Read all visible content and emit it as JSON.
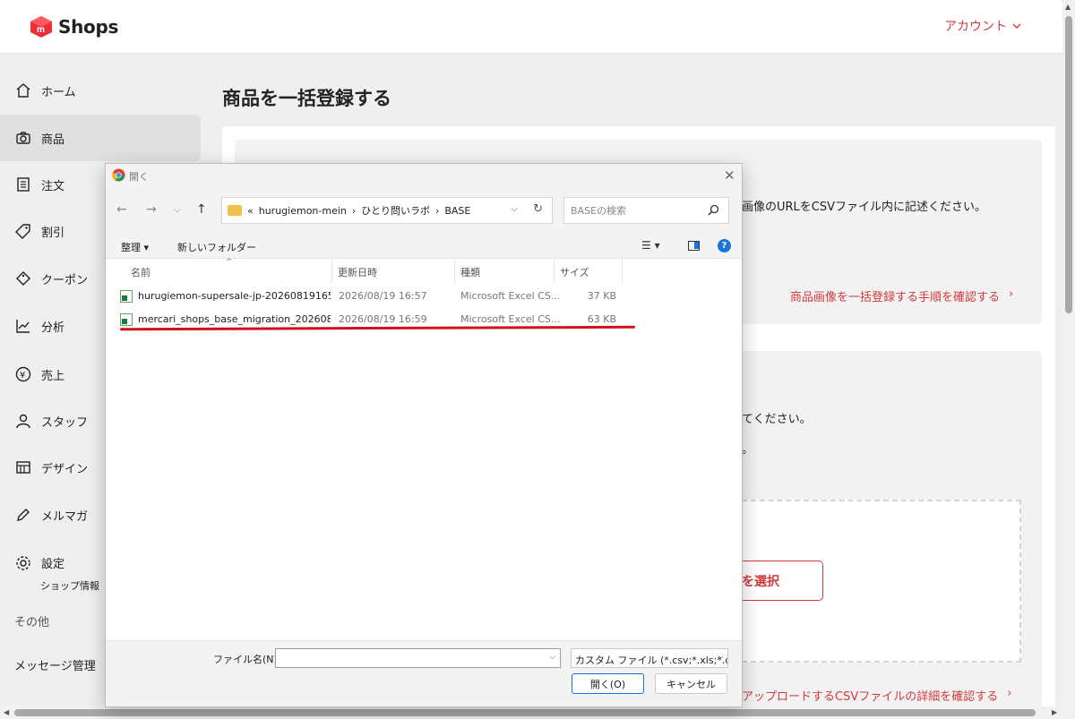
{
  "header": {
    "logo_text": "Shops",
    "account_label": "アカウント"
  },
  "sidebar": {
    "items": [
      {
        "label": "ホーム",
        "icon": "home-icon"
      },
      {
        "label": "商品",
        "icon": "camera-icon"
      },
      {
        "label": "注文",
        "icon": "list-icon"
      },
      {
        "label": "割引",
        "icon": "tag-icon"
      },
      {
        "label": "クーポン",
        "icon": "coupon-icon"
      },
      {
        "label": "分析",
        "icon": "chart-icon"
      },
      {
        "label": "売上",
        "icon": "yen-icon"
      },
      {
        "label": "スタッフ",
        "icon": "person-icon"
      },
      {
        "label": "デザイン",
        "icon": "design-icon"
      },
      {
        "label": "メルマガ",
        "icon": "pen-icon"
      },
      {
        "label": "設定",
        "icon": "gear-icon"
      }
    ],
    "settings_sub": "ショップ情報",
    "section_label": "その他",
    "message_label": "メッセージ管理"
  },
  "main": {
    "title": "商品を一括登録する",
    "card1_text": "画像のURLをCSVファイル内に記述ください。",
    "card1_link": "商品画像を一括登録する手順を確認する",
    "card2_text1": "てください。",
    "card2_text2": "。",
    "select_button": "を選択",
    "card2_link": "アップロードするCSVファイルの詳細を確認する"
  },
  "dialog": {
    "title": "開く",
    "path": {
      "prefix": "«",
      "parts": [
        "hurugiemon-mein",
        "ひとり問いラボ",
        "BASE"
      ]
    },
    "search_placeholder": "BASEの検索",
    "toolbar": {
      "organize": "整理 ▾",
      "new_folder": "新しいフォルダー"
    },
    "columns": [
      "名前",
      "更新日時",
      "種類",
      "サイズ"
    ],
    "files": [
      {
        "name": "hurugiemon-supersale-jp-2026081916553...",
        "date": "2026/08/19 16:57",
        "type": "Microsoft Excel CS...",
        "size": "37 KB"
      },
      {
        "name": "mercari_shops_base_migration_20260819...",
        "date": "2026/08/19 16:59",
        "type": "Microsoft Excel CS...",
        "size": "63 KB"
      }
    ],
    "filename_label": "ファイル名(N):",
    "filename_value": "",
    "filetype": "カスタム ファイル (*.csv;*.xls;*.com",
    "open_button": "開く(O)",
    "cancel_button": "キャンセル"
  },
  "colors": {
    "accent": "#d23b3b",
    "highlight_line": "#d0121b",
    "link_blue": "#1a73d9"
  }
}
